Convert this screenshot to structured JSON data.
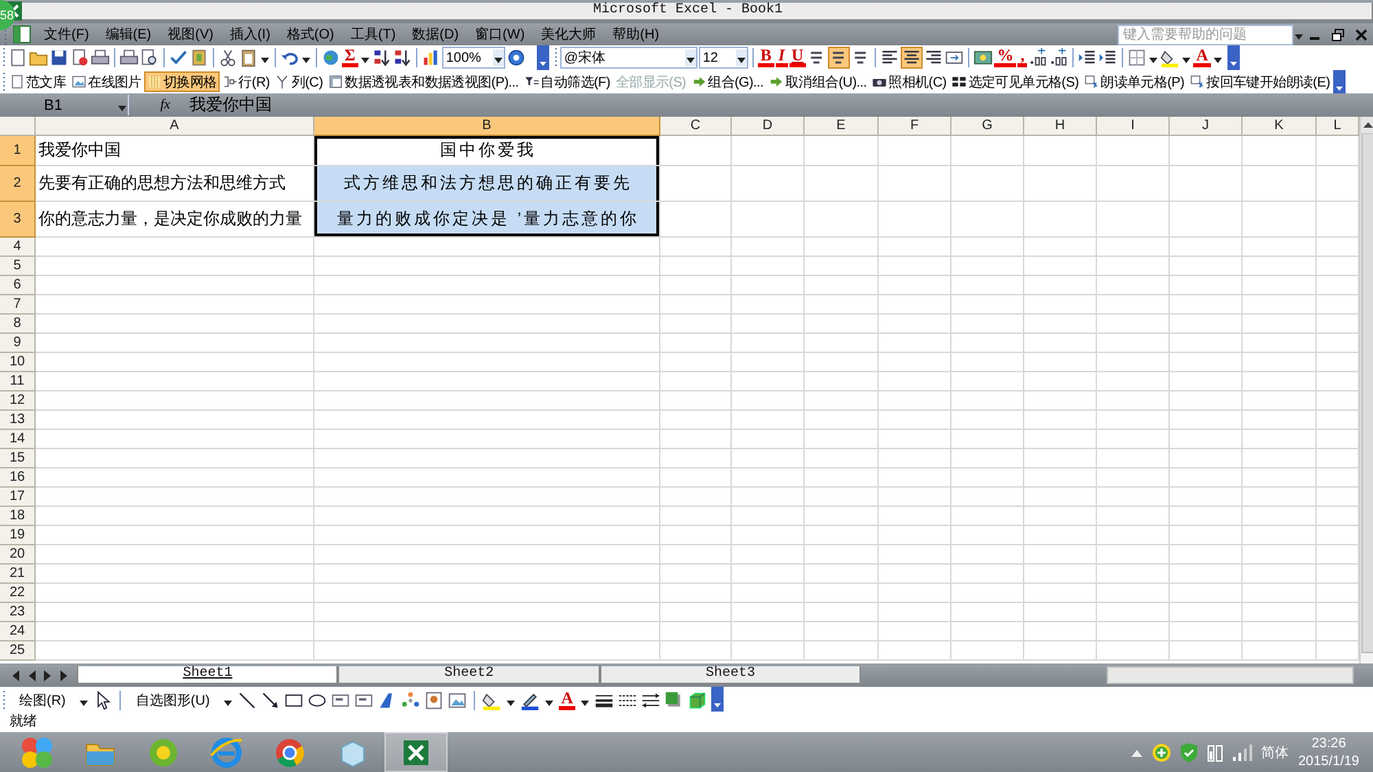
{
  "window": {
    "title": "Microsoft Excel - Book1"
  },
  "menu": [
    {
      "label": "文件(F)"
    },
    {
      "label": "编辑(E)"
    },
    {
      "label": "视图(V)"
    },
    {
      "label": "插入(I)"
    },
    {
      "label": "格式(O)"
    },
    {
      "label": "工具(T)"
    },
    {
      "label": "数据(D)"
    },
    {
      "label": "窗口(W)"
    },
    {
      "label": "美化大师"
    },
    {
      "label": "帮助(H)"
    }
  ],
  "help_search": {
    "placeholder": "键入需要帮助的问题"
  },
  "standard_toolbar": {
    "sum": "Σ",
    "zoom": "100%"
  },
  "format_toolbar": {
    "font": "@宋体",
    "size": "12",
    "bold": "B",
    "italic": "I",
    "underline": "U",
    "toggle_pressed": true,
    "align_center_pressed": true,
    "percent": "%",
    "comma": ",",
    "font_color": "A"
  },
  "extra_toolbar": [
    {
      "label": "范文库",
      "pressed": false,
      "disabled": false
    },
    {
      "label": "在线图片",
      "pressed": false,
      "disabled": false
    },
    {
      "label": "切换网格",
      "pressed": true,
      "disabled": false
    },
    {
      "label": "行(R)",
      "pressed": false,
      "disabled": false
    },
    {
      "label": "列(C)",
      "pressed": false,
      "disabled": false
    },
    {
      "label": "数据透视表和数据透视图(P)...",
      "pressed": false,
      "disabled": false
    },
    {
      "label": "自动筛选(F)",
      "pressed": false,
      "disabled": false
    },
    {
      "label": "全部显示(S)",
      "pressed": false,
      "disabled": true
    },
    {
      "label": "组合(G)...",
      "pressed": false,
      "disabled": false
    },
    {
      "label": "取消组合(U)...",
      "pressed": false,
      "disabled": false
    },
    {
      "label": "照相机(C)",
      "pressed": false,
      "disabled": false
    },
    {
      "label": "选定可见单元格(S)",
      "pressed": false,
      "disabled": false
    },
    {
      "label": "朗读单元格(P)",
      "pressed": false,
      "disabled": false
    },
    {
      "label": "按回车键开始朗读(E)",
      "pressed": false,
      "disabled": false
    }
  ],
  "formula_bar": {
    "name_box": "B1",
    "function_label": "fx",
    "value": "我爱你中国"
  },
  "columns": [
    {
      "label": "A",
      "selected": false
    },
    {
      "label": "B",
      "selected": true
    },
    {
      "label": "C",
      "selected": false
    },
    {
      "label": "D",
      "selected": false
    },
    {
      "label": "E",
      "selected": false
    },
    {
      "label": "F",
      "selected": false
    },
    {
      "label": "G",
      "selected": false
    },
    {
      "label": "H",
      "selected": false
    },
    {
      "label": "I",
      "selected": false
    },
    {
      "label": "J",
      "selected": false
    },
    {
      "label": "K",
      "selected": false
    },
    {
      "label": "L",
      "selected": false
    }
  ],
  "rows": [
    {
      "label": "1",
      "selected": true,
      "cells": [
        {
          "text": "我爱你中国",
          "selected": false,
          "active": false
        },
        {
          "text": "国中你爱我",
          "selected": true,
          "active": true
        }
      ]
    },
    {
      "label": "2",
      "selected": true,
      "cells": [
        {
          "text": "先要有正确的思想方法和思维方式",
          "selected": false,
          "active": false
        },
        {
          "text": "式方维思和法方想思的确正有要先",
          "selected": true,
          "active": false
        }
      ]
    },
    {
      "label": "3",
      "selected": true,
      "cells": [
        {
          "text": "你的意志力量，是决定你成败的力量",
          "selected": false,
          "active": false
        },
        {
          "text": "量力的败成你定决是 ’量力志意的你",
          "selected": true,
          "active": false
        }
      ]
    },
    {
      "label": "4",
      "selected": false,
      "cells": []
    },
    {
      "label": "5",
      "selected": false,
      "cells": []
    },
    {
      "label": "6",
      "selected": false,
      "cells": []
    },
    {
      "label": "7",
      "selected": false,
      "cells": []
    },
    {
      "label": "8",
      "selected": false,
      "cells": []
    },
    {
      "label": "9",
      "selected": false,
      "cells": []
    },
    {
      "label": "10",
      "selected": false,
      "cells": []
    },
    {
      "label": "11",
      "selected": false,
      "cells": []
    },
    {
      "label": "12",
      "selected": false,
      "cells": []
    },
    {
      "label": "13",
      "selected": false,
      "cells": []
    },
    {
      "label": "14",
      "selected": false,
      "cells": []
    },
    {
      "label": "15",
      "selected": false,
      "cells": []
    },
    {
      "label": "16",
      "selected": false,
      "cells": []
    },
    {
      "label": "17",
      "selected": false,
      "cells": []
    },
    {
      "label": "18",
      "selected": false,
      "cells": []
    },
    {
      "label": "19",
      "selected": false,
      "cells": []
    },
    {
      "label": "20",
      "selected": false,
      "cells": []
    },
    {
      "label": "21",
      "selected": false,
      "cells": []
    },
    {
      "label": "22",
      "selected": false,
      "cells": []
    },
    {
      "label": "23",
      "selected": false,
      "cells": []
    },
    {
      "label": "24",
      "selected": false,
      "cells": []
    },
    {
      "label": "25",
      "selected": false,
      "cells": []
    }
  ],
  "sheet_tabs": [
    {
      "label": "Sheet1",
      "selected": true
    },
    {
      "label": "Sheet2",
      "selected": false
    },
    {
      "label": "Sheet3",
      "selected": false
    }
  ],
  "drawing_toolbar": {
    "draw_menu": "绘图(R)",
    "autoshapes": "自选图形(U)",
    "font_color": "A"
  },
  "status_bar": {
    "text": "就绪"
  },
  "floating_badge": "58",
  "taskbar": {
    "ime": "简体",
    "time": "23:26",
    "date": "2015/1/19"
  }
}
